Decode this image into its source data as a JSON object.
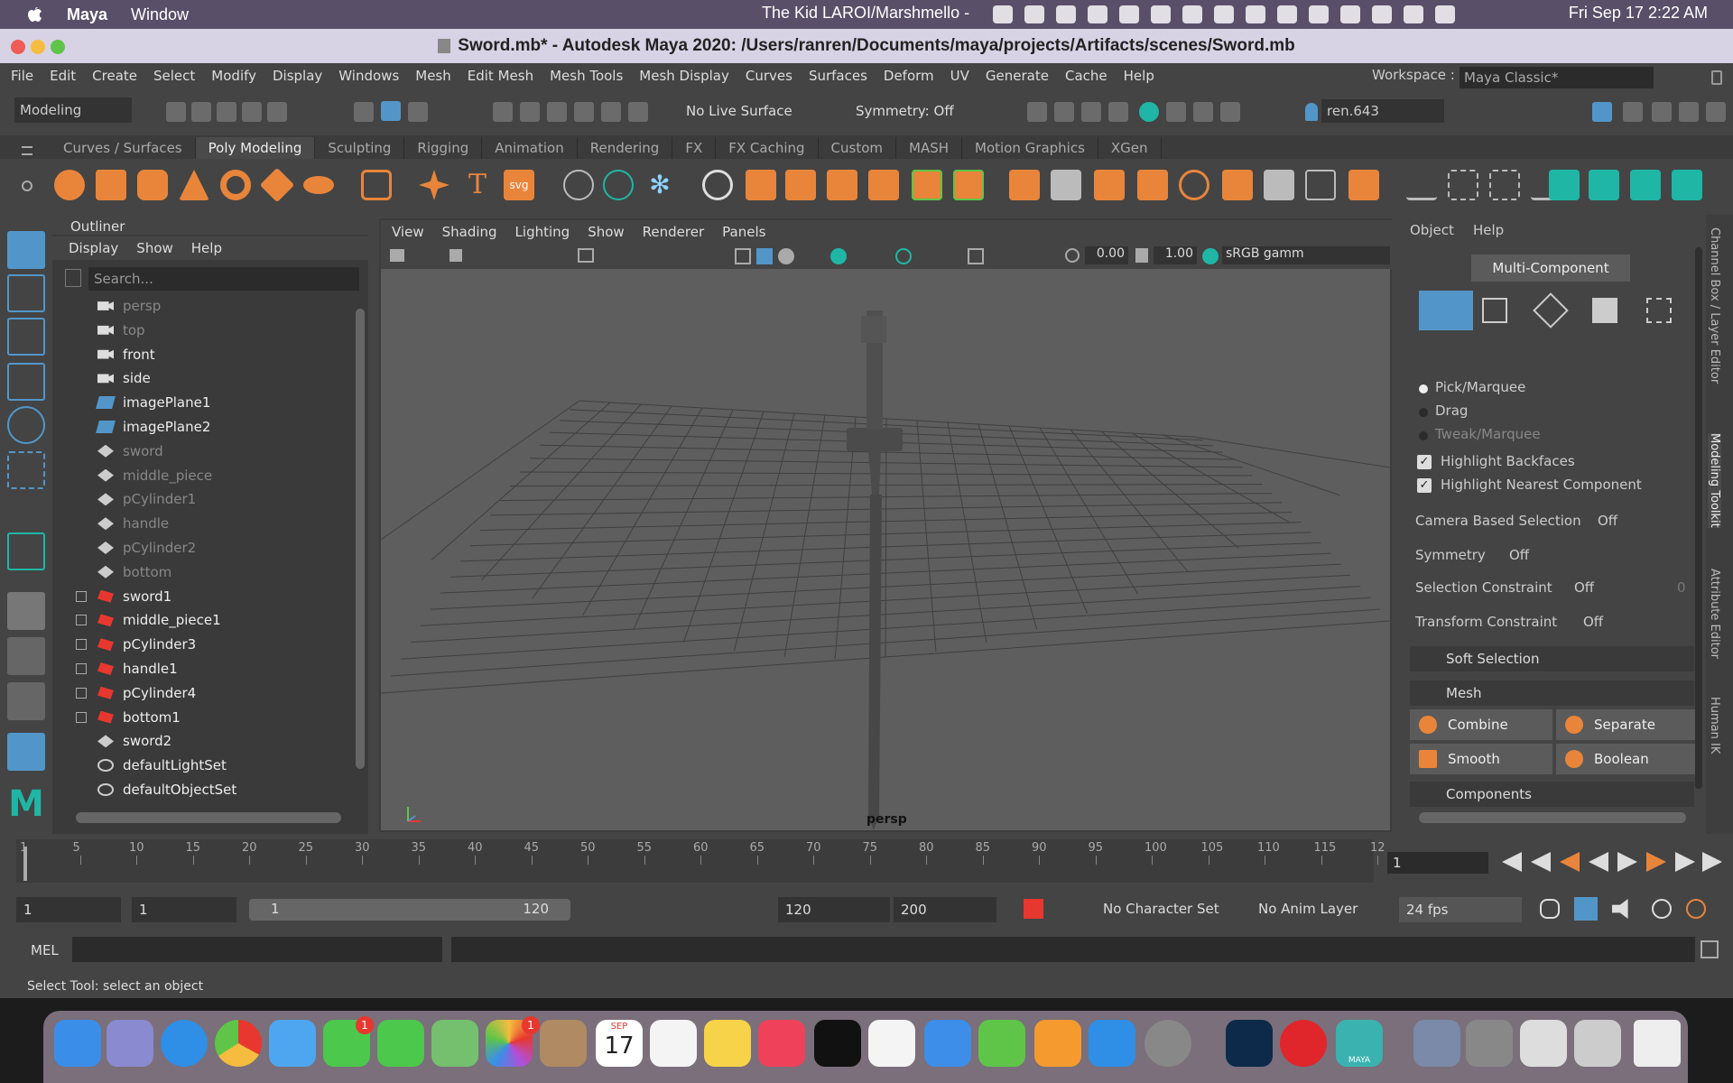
{
  "menubar": {
    "app": "Maya",
    "items": [
      "Window"
    ],
    "now_playing": "The Kid LAROI/Marshmello -",
    "clock": "Fri Sep 17  2:22 AM"
  },
  "window": {
    "title": "Sword.mb* - Autodesk Maya 2020: /Users/ranren/Documents/maya/projects/Artifacts/scenes/Sword.mb"
  },
  "main_menu": [
    "File",
    "Edit",
    "Create",
    "Select",
    "Modify",
    "Display",
    "Windows",
    "Mesh",
    "Edit Mesh",
    "Mesh Tools",
    "Mesh Display",
    "Curves",
    "Surfaces",
    "Deform",
    "UV",
    "Generate",
    "Cache",
    "Help"
  ],
  "workspace": {
    "label": "Workspace :",
    "value": "Maya Classic*"
  },
  "toolbar": {
    "mode": "Modeling",
    "live_surface": "No Live Surface",
    "symmetry": "Symmetry: Off",
    "user": "ren.643"
  },
  "shelf_tabs": [
    "Curves / Surfaces",
    "Poly Modeling",
    "Sculpting",
    "Rigging",
    "Animation",
    "Rendering",
    "FX",
    "FX Caching",
    "Custom",
    "MASH",
    "Motion Graphics",
    "XGen"
  ],
  "shelf_active": "Poly Modeling",
  "outliner": {
    "title": "Outliner",
    "menu": [
      "Display",
      "Show",
      "Help"
    ],
    "search_placeholder": "Search...",
    "items": [
      {
        "name": "persp",
        "dim": true,
        "icon": "camera"
      },
      {
        "name": "top",
        "dim": true,
        "icon": "camera"
      },
      {
        "name": "front",
        "dim": false,
        "icon": "camera"
      },
      {
        "name": "side",
        "dim": false,
        "icon": "camera"
      },
      {
        "name": "imagePlane1",
        "dim": false,
        "icon": "image-plane"
      },
      {
        "name": "imagePlane2",
        "dim": false,
        "icon": "image-plane"
      },
      {
        "name": "sword",
        "dim": true,
        "icon": "mesh"
      },
      {
        "name": "middle_piece",
        "dim": true,
        "icon": "mesh"
      },
      {
        "name": "pCylinder1",
        "dim": true,
        "icon": "mesh"
      },
      {
        "name": "handle",
        "dim": true,
        "icon": "mesh"
      },
      {
        "name": "pCylinder2",
        "dim": true,
        "icon": "mesh"
      },
      {
        "name": "bottom",
        "dim": true,
        "icon": "mesh"
      },
      {
        "name": "sword1",
        "dim": false,
        "icon": "transform",
        "expand": true
      },
      {
        "name": "middle_piece1",
        "dim": false,
        "icon": "transform",
        "expand": true
      },
      {
        "name": "pCylinder3",
        "dim": false,
        "icon": "transform",
        "expand": true
      },
      {
        "name": "handle1",
        "dim": false,
        "icon": "transform",
        "expand": true
      },
      {
        "name": "pCylinder4",
        "dim": false,
        "icon": "transform",
        "expand": true
      },
      {
        "name": "bottom1",
        "dim": false,
        "icon": "transform",
        "expand": true
      },
      {
        "name": "sword2",
        "dim": false,
        "icon": "mesh"
      },
      {
        "name": "defaultLightSet",
        "dim": false,
        "icon": "set"
      },
      {
        "name": "defaultObjectSet",
        "dim": false,
        "icon": "set"
      }
    ]
  },
  "viewport": {
    "menu": [
      "View",
      "Shading",
      "Lighting",
      "Show",
      "Renderer",
      "Panels"
    ],
    "exposure": "0.00",
    "gamma": "1.00",
    "color_space": "sRGB gamm",
    "camera_label": "persp"
  },
  "modeling_toolkit": {
    "menu": [
      "Object",
      "Help"
    ],
    "mode_button": "Multi-Component",
    "radios": [
      "Pick/Marquee",
      "Drag",
      "Tweak/Marquee"
    ],
    "checks": [
      "Highlight Backfaces",
      "Highlight Nearest Component"
    ],
    "options": [
      {
        "label": "Camera Based Selection",
        "value": "Off"
      },
      {
        "label": "Symmetry",
        "value": "Off"
      },
      {
        "label": "Selection Constraint",
        "value": "Off",
        "extra": "0"
      },
      {
        "label": "Transform Constraint",
        "value": "Off"
      }
    ],
    "sections": [
      "Soft Selection",
      "Mesh",
      "Components"
    ],
    "mesh_buttons": [
      "Combine",
      "Separate",
      "Smooth",
      "Boolean"
    ]
  },
  "side_tabs": [
    "Channel Box / Layer Editor",
    "Modeling Toolkit",
    "Attribute Editor",
    "Human IK"
  ],
  "timeline": {
    "ticks": [
      "1",
      "5",
      "10",
      "15",
      "20",
      "25",
      "30",
      "35",
      "40",
      "45",
      "50",
      "55",
      "60",
      "65",
      "70",
      "75",
      "80",
      "85",
      "90",
      "95",
      "100",
      "105",
      "110",
      "115",
      "12"
    ],
    "current_frame": "1"
  },
  "range": {
    "start": "1",
    "playback_start": "1",
    "slider_start": "1",
    "slider_end": "120",
    "playback_end": "120",
    "end": "200",
    "character_set": "No Character Set",
    "anim_layer": "No Anim Layer",
    "fps": "24 fps"
  },
  "mel": {
    "label": "MEL"
  },
  "help_line": "Select Tool: select an object",
  "dock": {
    "facetime_badge": "1",
    "photos_badge": "1",
    "calendar_month": "SEP",
    "calendar_day": "17",
    "maya_label": "MAYA"
  },
  "colors": {
    "accent": "#e9853b",
    "selected": "#5296c9",
    "teal": "#1fb6a6"
  }
}
